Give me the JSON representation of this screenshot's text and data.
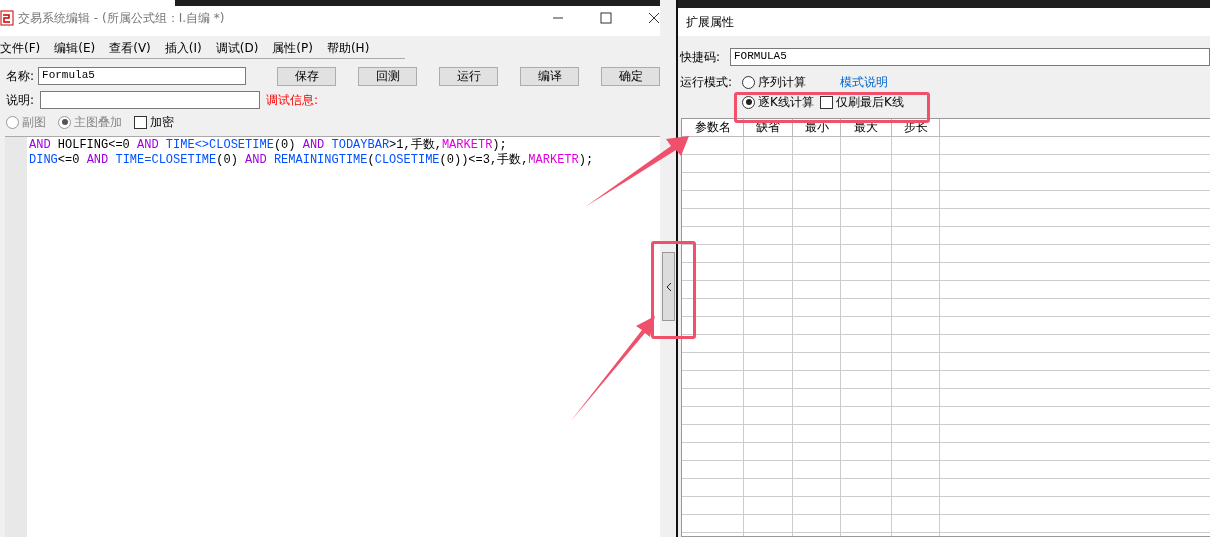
{
  "editor_window": {
    "title": "交易系统编辑 - (所属公式组：I.自编 *)",
    "menu": [
      "文件(F)",
      "编辑(E)",
      "查看(V)",
      "插入(I)",
      "调试(D)",
      "属性(P)",
      "帮助(H)"
    ],
    "name_label": "名称:",
    "name_value": "Formula5",
    "buttons": [
      "保存",
      "回测",
      "运行",
      "编译",
      "确定"
    ],
    "desc_label": "说明:",
    "debug_label": "调试信息:",
    "options": [
      {
        "kind": "radio",
        "label": "副图",
        "selected": false,
        "disabled": true
      },
      {
        "kind": "radio",
        "label": "主图叠加",
        "selected": true,
        "disabled": true
      },
      {
        "kind": "checkbox",
        "label": "加密",
        "checked": false,
        "disabled": false
      }
    ],
    "code_lines": [
      [
        {
          "kind": "keyword",
          "text": "AND"
        },
        {
          "kind": "plain",
          "text": " HOLFING<=0 "
        },
        {
          "kind": "keyword",
          "text": "AND "
        },
        {
          "kind": "function",
          "text": "TIME<>CLOSETIME"
        },
        {
          "kind": "plain",
          "text": "(0) "
        },
        {
          "kind": "keyword",
          "text": "AND "
        },
        {
          "kind": "function",
          "text": "TODAYBAR"
        },
        {
          "kind": "plain",
          "text": ">1,手数,"
        },
        {
          "kind": "variable",
          "text": "MARKETR"
        },
        {
          "kind": "plain",
          "text": ");"
        }
      ],
      [
        {
          "kind": "function",
          "text": "DING"
        },
        {
          "kind": "plain",
          "text": "<=0 "
        },
        {
          "kind": "keyword",
          "text": "AND "
        },
        {
          "kind": "function",
          "text": "TIME=CLOSETIME"
        },
        {
          "kind": "plain",
          "text": "(0) "
        },
        {
          "kind": "keyword",
          "text": "AND "
        },
        {
          "kind": "function",
          "text": "REMAININGTIME"
        },
        {
          "kind": "plain",
          "text": "("
        },
        {
          "kind": "function",
          "text": "CLOSETIME"
        },
        {
          "kind": "plain",
          "text": "(0))<=3,手数,"
        },
        {
          "kind": "variable",
          "text": "MARKETR"
        },
        {
          "kind": "plain",
          "text": ");"
        }
      ]
    ]
  },
  "extended_panel": {
    "title": "扩展属性",
    "shortcut_label": "快捷码:",
    "shortcut_value": "FORMULA5",
    "run_mode_label": "运行模式:",
    "run_modes": [
      {
        "label": "序列计算",
        "selected": false
      },
      {
        "label": "逐K线计算",
        "selected": true
      }
    ],
    "mode_help_link": "模式说明",
    "last_bar_only": {
      "label": "仅刷最后K线",
      "checked": false
    },
    "table": {
      "columns": [
        "参数名",
        "缺省",
        "最小",
        "最大",
        "步长"
      ]
    }
  }
}
